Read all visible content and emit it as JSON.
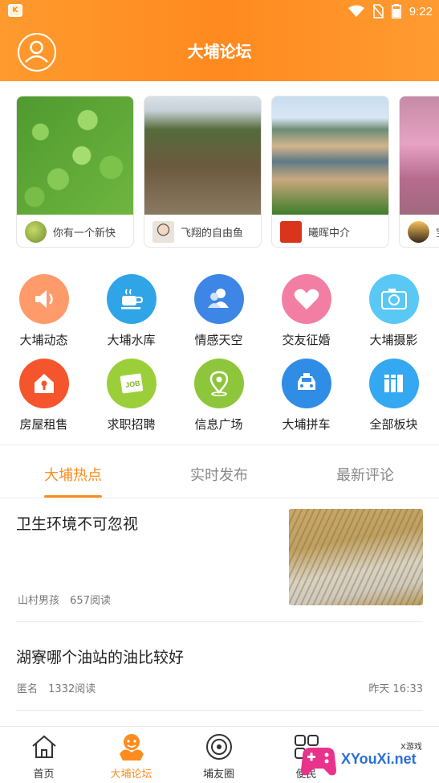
{
  "status_bar": {
    "time": "9:22",
    "app_badge": "K"
  },
  "header": {
    "title": "大埔论坛"
  },
  "banner_cards": [
    {
      "user": "你有一个新快"
    },
    {
      "user": "飞翔的自由鱼"
    },
    {
      "user": "曦晖中介"
    },
    {
      "user": "宝"
    }
  ],
  "categories": [
    {
      "label": "大埔动态",
      "icon": "speaker-icon",
      "color": "#ff9a6a"
    },
    {
      "label": "大埔水库",
      "icon": "coffee-cup-icon",
      "color": "#2fa5e8"
    },
    {
      "label": "情感天空",
      "icon": "users-icon",
      "color": "#3d86e6"
    },
    {
      "label": "交友征婚",
      "icon": "heart-icon",
      "color": "#f27fa3"
    },
    {
      "label": "大埔摄影",
      "icon": "camera-icon",
      "color": "#5ac8f5"
    },
    {
      "label": "房屋租售",
      "icon": "house-icon",
      "color": "#f5552c"
    },
    {
      "label": "求职招聘",
      "icon": "job-icon",
      "color": "#9bcf3a"
    },
    {
      "label": "信息广场",
      "icon": "location-pin-icon",
      "color": "#8ec63b"
    },
    {
      "label": "大埔拼车",
      "icon": "taxi-icon",
      "color": "#2f8de6"
    },
    {
      "label": "全部板块",
      "icon": "books-icon",
      "color": "#34a8f0"
    }
  ],
  "tabs": [
    {
      "label": "大埔热点",
      "active": true
    },
    {
      "label": "实时发布",
      "active": false
    },
    {
      "label": "最新评论",
      "active": false
    }
  ],
  "posts": [
    {
      "title": "卫生环境不可忽视",
      "author": "山村男孩",
      "reads": "657阅读",
      "time": ""
    },
    {
      "title": "湖寮哪个油站的油比较好",
      "author": "匿名",
      "reads": "1332阅读",
      "time": "昨天 16:33"
    }
  ],
  "bottom_nav": [
    {
      "label": "首页",
      "icon": "home-icon",
      "active": false
    },
    {
      "label": "大埔论坛",
      "icon": "forum-icon",
      "active": true
    },
    {
      "label": "埔友圈",
      "icon": "circle-icon",
      "active": false
    },
    {
      "label": "便民",
      "icon": "grid-icon",
      "active": false
    }
  ],
  "watermark": {
    "text": "XYouXi.net",
    "small": "X游戏"
  },
  "colors": {
    "accent": "#ff8c1e",
    "header": "#ff9a2e"
  }
}
